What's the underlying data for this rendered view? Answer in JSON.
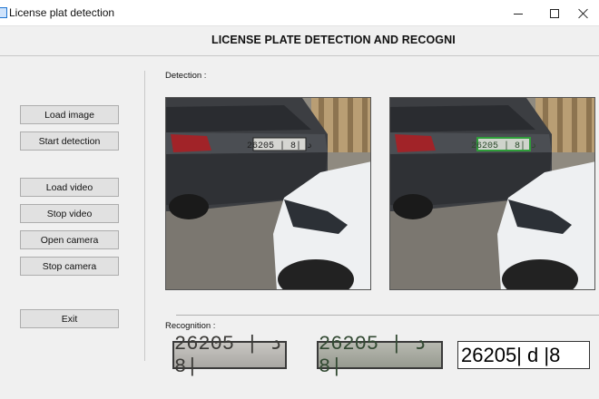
{
  "window": {
    "title": "License plat detection"
  },
  "header": {
    "title": "LICENSE PLATE DETECTION AND RECOGNI"
  },
  "buttons": {
    "load_image": "Load image",
    "start_detection": "Start detection",
    "load_video": "Load video",
    "stop_video": "Stop video",
    "open_camera": "Open camera",
    "stop_camera": "Stop camera",
    "exit": "Exit"
  },
  "detection": {
    "label": "Detection :",
    "plate_text_on_car": "26205 | د |8"
  },
  "recognition": {
    "label": "Recognition :",
    "plate_crop_original": "26205 | د |8",
    "plate_crop_processed": "26205 | د |8",
    "recognized_text": "26205| d |8"
  },
  "colors": {
    "window_bg": "#f0f0f0",
    "button_bg": "#e1e1e1",
    "detection_box": "#2f9d3a"
  }
}
